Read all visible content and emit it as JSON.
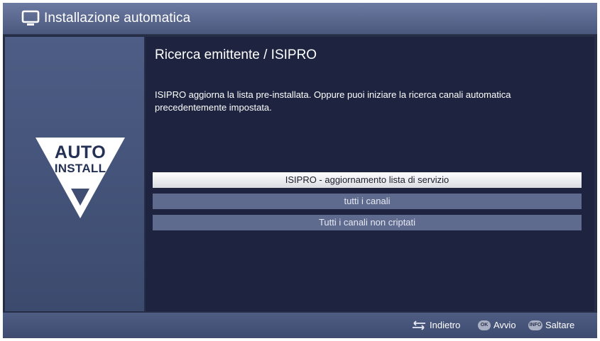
{
  "window": {
    "title": "Installazione automatica",
    "icon": "tv-icon"
  },
  "logo": {
    "line1": "AUTO",
    "line2": "INSTALL",
    "icon": "auto-install-triangle-icon"
  },
  "main": {
    "heading": "Ricerca emittente / ISIPRO",
    "description": "ISIPRO aggiorna la lista pre-installata. Oppure puoi iniziare la ricerca canali automatica precedentemente impostata.",
    "options": [
      {
        "label": "ISIPRO - aggiornamento lista di servizio",
        "selected": true
      },
      {
        "label": "tutti i canali",
        "selected": false
      },
      {
        "label": "Tutti i canali non criptati",
        "selected": false
      }
    ]
  },
  "footer": {
    "back_label": "Indietro",
    "back_icon": "back-arrows-icon",
    "ok_key": "OK",
    "ok_label": "Avvio",
    "info_key": "INFO",
    "info_label": "Saltare"
  },
  "colors": {
    "background": "#262e45",
    "titlebar": "#5f6d95",
    "panel": "#45547b",
    "content": "#1e2440",
    "option_selected": "#ffffff",
    "option_normal": "#5e6b8f"
  }
}
